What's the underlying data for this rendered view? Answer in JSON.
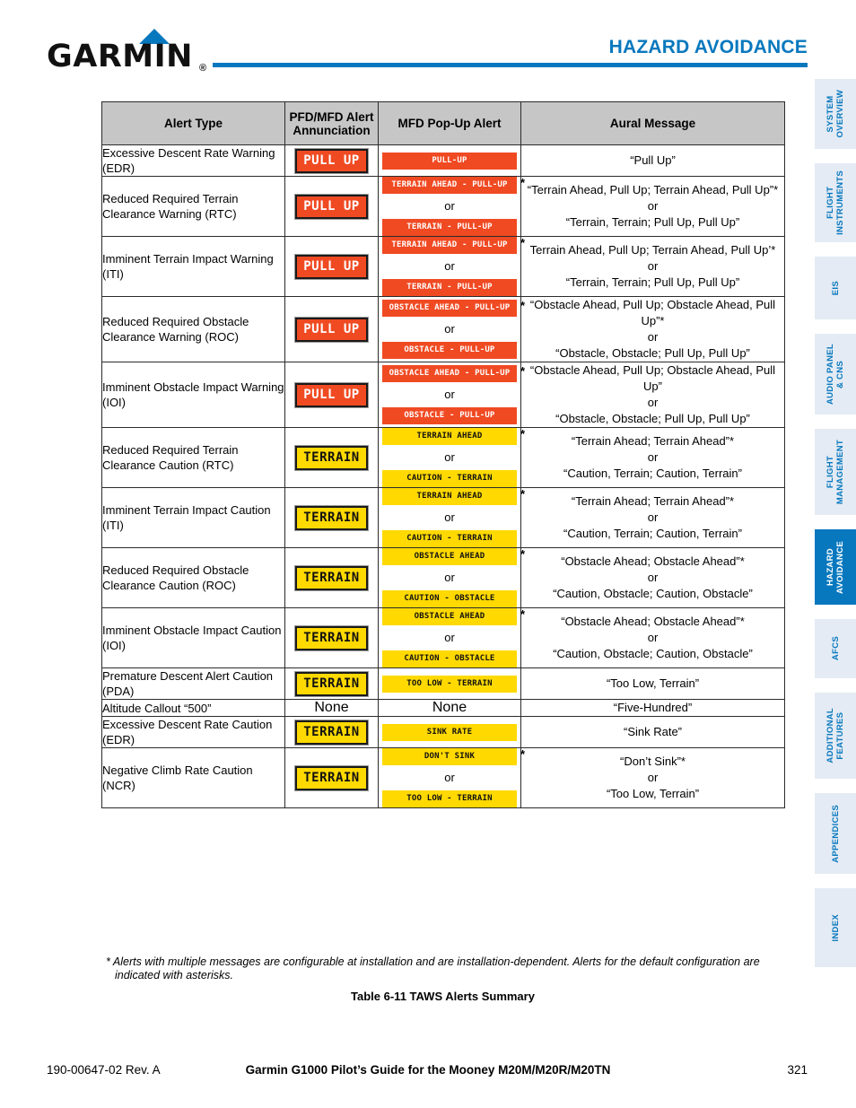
{
  "header": {
    "logo_text": "GARMIN",
    "logo_registered": "®",
    "chapter_title": "HAZARD AVOIDANCE",
    "accent_color": "#0878BE"
  },
  "sidebar": {
    "tabs": [
      {
        "label": "SYSTEM\nOVERVIEW",
        "active": false
      },
      {
        "label": "FLIGHT\nINSTRUMENTS",
        "active": false
      },
      {
        "label": "EIS",
        "active": false
      },
      {
        "label": "AUDIO PANEL\n& CNS",
        "active": false
      },
      {
        "label": "FLIGHT\nMANAGEMENT",
        "active": false
      },
      {
        "label": "HAZARD\nAVOIDANCE",
        "active": true
      },
      {
        "label": "AFCS",
        "active": false
      },
      {
        "label": "ADDITIONAL\nFEATURES",
        "active": false
      },
      {
        "label": "APPENDICES",
        "active": false
      },
      {
        "label": "INDEX",
        "active": false
      }
    ],
    "inactive_bg": "#E4EBF4",
    "active_bg": "#0878BE"
  },
  "table": {
    "headers": [
      "Alert Type",
      "PFD/MFD Alert Annunciation",
      "MFD Pop-Up Alert",
      "Aural Message"
    ],
    "header_bg": "#C6C6C6",
    "warning_color": "#F04A23",
    "caution_color": "#FFD900",
    "rows": [
      {
        "alert_type": "Excessive Descent Rate Warning (EDR)",
        "pfd": {
          "type": "chip",
          "style": "pullup",
          "text": "PULL  UP"
        },
        "popup": [
          {
            "style": "orange",
            "text": "PULL-UP",
            "star": false
          }
        ],
        "aural": [
          "“Pull Up”"
        ]
      },
      {
        "alert_type": "Reduced Required Terrain Clearance Warning (RTC)",
        "pfd": {
          "type": "chip",
          "style": "pullup",
          "text": "PULL  UP"
        },
        "popup": [
          {
            "style": "orange",
            "text": "TERRAIN AHEAD - PULL-UP",
            "star": true
          },
          {
            "style": "orange",
            "text": "TERRAIN - PULL-UP",
            "star": false
          }
        ],
        "aural": [
          "“Terrain Ahead, Pull Up; Terrain Ahead, Pull Up”*",
          "“Terrain, Terrain; Pull Up, Pull Up”"
        ]
      },
      {
        "alert_type": "Imminent Terrain Impact Warning (ITI)",
        "pfd": {
          "type": "chip",
          "style": "pullup",
          "text": "PULL  UP"
        },
        "popup": [
          {
            "style": "orange",
            "text": "TERRAIN AHEAD - PULL-UP",
            "star": true
          },
          {
            "style": "orange",
            "text": "TERRAIN - PULL-UP",
            "star": false
          }
        ],
        "aural": [
          "Terrain Ahead, Pull Up; Terrain Ahead, Pull Up’*",
          "“Terrain, Terrain; Pull Up, Pull Up”"
        ]
      },
      {
        "alert_type": "Reduced Required Obstacle Clearance Warning (ROC)",
        "pfd": {
          "type": "chip",
          "style": "pullup",
          "text": "PULL  UP"
        },
        "popup": [
          {
            "style": "orange",
            "text": "OBSTACLE AHEAD - PULL-UP",
            "star": true
          },
          {
            "style": "orange",
            "text": "OBSTACLE - PULL-UP",
            "star": false
          }
        ],
        "aural": [
          "“Obstacle Ahead, Pull Up; Obstacle Ahead, Pull Up”*",
          "“Obstacle, Obstacle; Pull Up, Pull Up”"
        ]
      },
      {
        "alert_type": "Imminent Obstacle Impact Warning (IOI)",
        "pfd": {
          "type": "chip",
          "style": "pullup",
          "text": "PULL  UP"
        },
        "popup": [
          {
            "style": "orange",
            "text": "OBSTACLE AHEAD - PULL-UP",
            "star": true
          },
          {
            "style": "orange",
            "text": "OBSTACLE - PULL-UP",
            "star": false
          }
        ],
        "aural": [
          "“Obstacle Ahead, Pull Up; Obstacle Ahead, Pull Up”",
          "“Obstacle, Obstacle; Pull Up, Pull Up”"
        ]
      },
      {
        "alert_type": "Reduced Required Terrain Clearance Caution (RTC)",
        "pfd": {
          "type": "chip",
          "style": "terrain",
          "text": "TERRAIN"
        },
        "popup": [
          {
            "style": "yellow",
            "text": "TERRAIN AHEAD",
            "star": true
          },
          {
            "style": "yellow",
            "text": "CAUTION - TERRAIN",
            "star": false
          }
        ],
        "aural": [
          "“Terrain Ahead; Terrain Ahead”*",
          "“Caution, Terrain; Caution, Terrain”"
        ]
      },
      {
        "alert_type": "Imminent Terrain Impact Caution (ITI)",
        "pfd": {
          "type": "chip",
          "style": "terrain",
          "text": "TERRAIN"
        },
        "popup": [
          {
            "style": "yellow",
            "text": "TERRAIN AHEAD",
            "star": true
          },
          {
            "style": "yellow",
            "text": "CAUTION - TERRAIN",
            "star": false
          }
        ],
        "aural": [
          "“Terrain Ahead; Terrain Ahead”*",
          "“Caution, Terrain; Caution, Terrain”"
        ]
      },
      {
        "alert_type": "Reduced Required Obstacle Clearance Caution (ROC)",
        "pfd": {
          "type": "chip",
          "style": "terrain",
          "text": "TERRAIN"
        },
        "popup": [
          {
            "style": "yellow",
            "text": "OBSTACLE AHEAD",
            "star": true
          },
          {
            "style": "yellow",
            "text": "CAUTION - OBSTACLE",
            "star": false
          }
        ],
        "aural": [
          "“Obstacle Ahead; Obstacle Ahead”*",
          "“Caution, Obstacle; Caution, Obstacle”"
        ]
      },
      {
        "alert_type": "Imminent Obstacle Impact Caution (IOI)",
        "pfd": {
          "type": "chip",
          "style": "terrain",
          "text": "TERRAIN"
        },
        "popup": [
          {
            "style": "yellow",
            "text": "OBSTACLE AHEAD",
            "star": true
          },
          {
            "style": "yellow",
            "text": "CAUTION - OBSTACLE",
            "star": false
          }
        ],
        "aural": [
          "“Obstacle Ahead; Obstacle Ahead”*",
          "“Caution, Obstacle; Caution, Obstacle”"
        ]
      },
      {
        "alert_type": "Premature Descent Alert Caution (PDA)",
        "pfd": {
          "type": "chip",
          "style": "terrain",
          "text": "TERRAIN"
        },
        "popup": [
          {
            "style": "yellow",
            "text": "TOO LOW - TERRAIN",
            "star": false
          }
        ],
        "aural": [
          "“Too Low, Terrain”"
        ]
      },
      {
        "alert_type": "Altitude Callout “500”",
        "pfd": {
          "type": "text",
          "text": "None"
        },
        "popup": [
          {
            "style": "none",
            "text": "None",
            "star": false
          }
        ],
        "aural": [
          "“Five-Hundred”"
        ]
      },
      {
        "alert_type": "Excessive Descent Rate Caution (EDR)",
        "pfd": {
          "type": "chip",
          "style": "terrain",
          "text": "TERRAIN"
        },
        "popup": [
          {
            "style": "yellow",
            "text": "SINK RATE",
            "star": false
          }
        ],
        "aural": [
          "“Sink Rate”"
        ]
      },
      {
        "alert_type": "Negative Climb Rate Caution (NCR)",
        "pfd": {
          "type": "chip",
          "style": "terrain",
          "text": "TERRAIN"
        },
        "popup": [
          {
            "style": "yellow",
            "text": "DON'T SINK",
            "star": true
          },
          {
            "style": "yellow",
            "text": "TOO LOW - TERRAIN",
            "star": false
          }
        ],
        "aural": [
          "“Don’t Sink”*",
          "“Too Low, Terrain”"
        ]
      }
    ],
    "or_separator": "or"
  },
  "footnote": "* Alerts with multiple messages are configurable at installation and are installation-dependent.  Alerts for the default configuration are indicated with asterisks.",
  "caption": "Table 6-11  TAWS Alerts Summary",
  "footer": {
    "left": "190-00647-02  Rev. A",
    "center": "Garmin G1000 Pilot’s Guide for the Mooney M20M/M20R/M20TN",
    "right": "321"
  }
}
